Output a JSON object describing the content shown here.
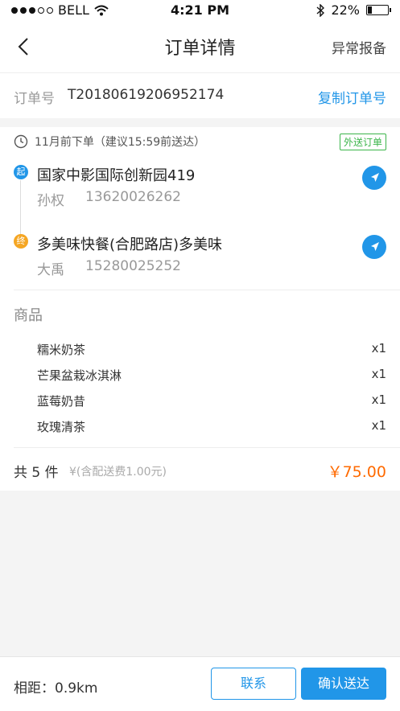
{
  "status_bar": {
    "carrier": "BELL",
    "time": "4:21 PM",
    "battery": "22%",
    "battery_level": 0.22
  },
  "nav": {
    "title": "订单详情",
    "action": "异常报备"
  },
  "order": {
    "label": "订单号",
    "number": "T20180619206952174",
    "copy_label": "复制订单号"
  },
  "delivery": {
    "time_text": "11月前下单（建议15:59前送达）",
    "tag": "外送订单",
    "start": {
      "badge": "起",
      "address": "国家中影国际创新园419",
      "name": "孙权",
      "phone": "13620026262"
    },
    "end": {
      "badge": "终",
      "address": "多美味快餐(合肥路店)多美味",
      "name": "大禹",
      "phone": "15280025252"
    }
  },
  "goods": {
    "title": "商品",
    "items": [
      {
        "name": "糯米奶茶",
        "qty": "x1"
      },
      {
        "name": "芒果盆栽冰淇淋",
        "qty": "x1"
      },
      {
        "name": "蓝莓奶昔",
        "qty": "x1"
      },
      {
        "name": "玫瑰清茶",
        "qty": "x1"
      }
    ]
  },
  "summary": {
    "count_text": "共 5 件",
    "fee_note": "¥(含配送费1.00元)",
    "total": "￥75.00"
  },
  "bottom": {
    "distance": "相距：0.9km",
    "contact_label": "联系",
    "confirm_label": "确认送达"
  },
  "colors": {
    "accent": "#2196e8",
    "price": "#ff6a00",
    "tag": "#3bb54a",
    "end_badge": "#f5a623"
  }
}
